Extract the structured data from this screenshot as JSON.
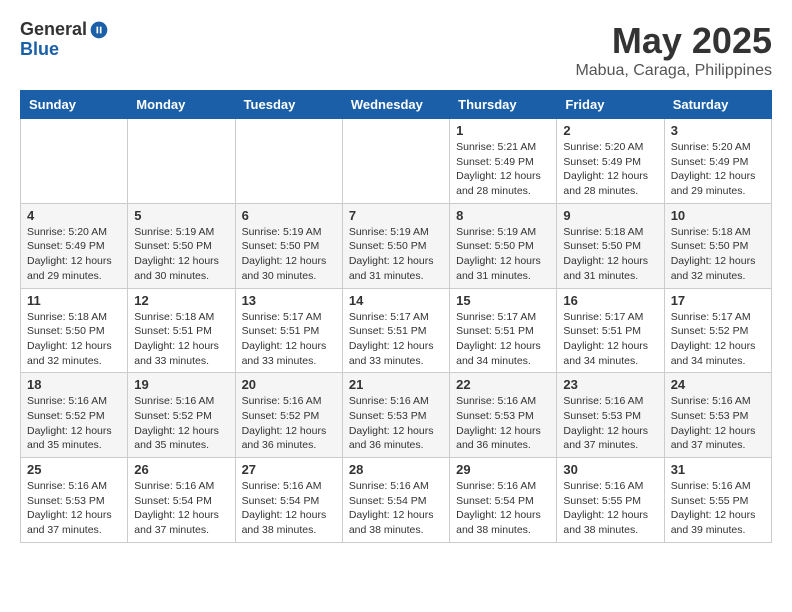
{
  "logo": {
    "general": "General",
    "blue": "Blue"
  },
  "title": "May 2025",
  "subtitle": "Mabua, Caraga, Philippines",
  "days_of_week": [
    "Sunday",
    "Monday",
    "Tuesday",
    "Wednesday",
    "Thursday",
    "Friday",
    "Saturday"
  ],
  "weeks": [
    [
      {
        "day": "",
        "info": ""
      },
      {
        "day": "",
        "info": ""
      },
      {
        "day": "",
        "info": ""
      },
      {
        "day": "",
        "info": ""
      },
      {
        "day": "1",
        "info": "Sunrise: 5:21 AM\nSunset: 5:49 PM\nDaylight: 12 hours\nand 28 minutes."
      },
      {
        "day": "2",
        "info": "Sunrise: 5:20 AM\nSunset: 5:49 PM\nDaylight: 12 hours\nand 28 minutes."
      },
      {
        "day": "3",
        "info": "Sunrise: 5:20 AM\nSunset: 5:49 PM\nDaylight: 12 hours\nand 29 minutes."
      }
    ],
    [
      {
        "day": "4",
        "info": "Sunrise: 5:20 AM\nSunset: 5:49 PM\nDaylight: 12 hours\nand 29 minutes."
      },
      {
        "day": "5",
        "info": "Sunrise: 5:19 AM\nSunset: 5:50 PM\nDaylight: 12 hours\nand 30 minutes."
      },
      {
        "day": "6",
        "info": "Sunrise: 5:19 AM\nSunset: 5:50 PM\nDaylight: 12 hours\nand 30 minutes."
      },
      {
        "day": "7",
        "info": "Sunrise: 5:19 AM\nSunset: 5:50 PM\nDaylight: 12 hours\nand 31 minutes."
      },
      {
        "day": "8",
        "info": "Sunrise: 5:19 AM\nSunset: 5:50 PM\nDaylight: 12 hours\nand 31 minutes."
      },
      {
        "day": "9",
        "info": "Sunrise: 5:18 AM\nSunset: 5:50 PM\nDaylight: 12 hours\nand 31 minutes."
      },
      {
        "day": "10",
        "info": "Sunrise: 5:18 AM\nSunset: 5:50 PM\nDaylight: 12 hours\nand 32 minutes."
      }
    ],
    [
      {
        "day": "11",
        "info": "Sunrise: 5:18 AM\nSunset: 5:50 PM\nDaylight: 12 hours\nand 32 minutes."
      },
      {
        "day": "12",
        "info": "Sunrise: 5:18 AM\nSunset: 5:51 PM\nDaylight: 12 hours\nand 33 minutes."
      },
      {
        "day": "13",
        "info": "Sunrise: 5:17 AM\nSunset: 5:51 PM\nDaylight: 12 hours\nand 33 minutes."
      },
      {
        "day": "14",
        "info": "Sunrise: 5:17 AM\nSunset: 5:51 PM\nDaylight: 12 hours\nand 33 minutes."
      },
      {
        "day": "15",
        "info": "Sunrise: 5:17 AM\nSunset: 5:51 PM\nDaylight: 12 hours\nand 34 minutes."
      },
      {
        "day": "16",
        "info": "Sunrise: 5:17 AM\nSunset: 5:51 PM\nDaylight: 12 hours\nand 34 minutes."
      },
      {
        "day": "17",
        "info": "Sunrise: 5:17 AM\nSunset: 5:52 PM\nDaylight: 12 hours\nand 34 minutes."
      }
    ],
    [
      {
        "day": "18",
        "info": "Sunrise: 5:16 AM\nSunset: 5:52 PM\nDaylight: 12 hours\nand 35 minutes."
      },
      {
        "day": "19",
        "info": "Sunrise: 5:16 AM\nSunset: 5:52 PM\nDaylight: 12 hours\nand 35 minutes."
      },
      {
        "day": "20",
        "info": "Sunrise: 5:16 AM\nSunset: 5:52 PM\nDaylight: 12 hours\nand 36 minutes."
      },
      {
        "day": "21",
        "info": "Sunrise: 5:16 AM\nSunset: 5:53 PM\nDaylight: 12 hours\nand 36 minutes."
      },
      {
        "day": "22",
        "info": "Sunrise: 5:16 AM\nSunset: 5:53 PM\nDaylight: 12 hours\nand 36 minutes."
      },
      {
        "day": "23",
        "info": "Sunrise: 5:16 AM\nSunset: 5:53 PM\nDaylight: 12 hours\nand 37 minutes."
      },
      {
        "day": "24",
        "info": "Sunrise: 5:16 AM\nSunset: 5:53 PM\nDaylight: 12 hours\nand 37 minutes."
      }
    ],
    [
      {
        "day": "25",
        "info": "Sunrise: 5:16 AM\nSunset: 5:53 PM\nDaylight: 12 hours\nand 37 minutes."
      },
      {
        "day": "26",
        "info": "Sunrise: 5:16 AM\nSunset: 5:54 PM\nDaylight: 12 hours\nand 37 minutes."
      },
      {
        "day": "27",
        "info": "Sunrise: 5:16 AM\nSunset: 5:54 PM\nDaylight: 12 hours\nand 38 minutes."
      },
      {
        "day": "28",
        "info": "Sunrise: 5:16 AM\nSunset: 5:54 PM\nDaylight: 12 hours\nand 38 minutes."
      },
      {
        "day": "29",
        "info": "Sunrise: 5:16 AM\nSunset: 5:54 PM\nDaylight: 12 hours\nand 38 minutes."
      },
      {
        "day": "30",
        "info": "Sunrise: 5:16 AM\nSunset: 5:55 PM\nDaylight: 12 hours\nand 38 minutes."
      },
      {
        "day": "31",
        "info": "Sunrise: 5:16 AM\nSunset: 5:55 PM\nDaylight: 12 hours\nand 39 minutes."
      }
    ]
  ]
}
